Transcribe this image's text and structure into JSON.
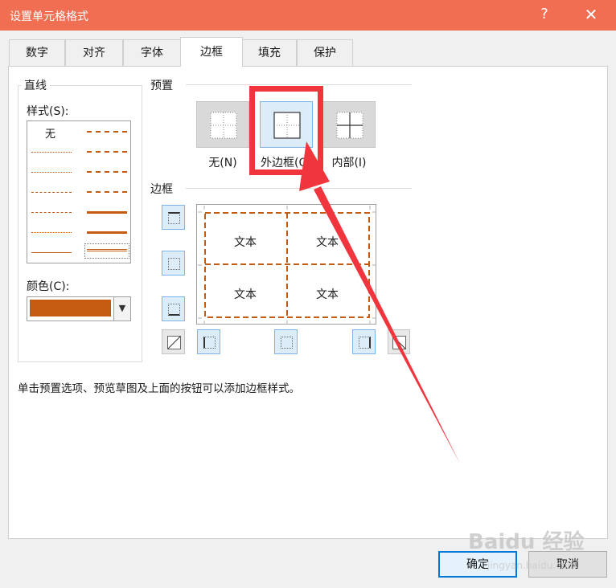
{
  "window": {
    "title": "设置单元格格式",
    "help": "?",
    "close": "✕"
  },
  "tabs": [
    "数字",
    "对齐",
    "字体",
    "边框",
    "填充",
    "保护"
  ],
  "active_tab": "边框",
  "line_group": {
    "legend": "直线",
    "style_label": "样式(S):",
    "none_label": "无",
    "color_label": "颜色(C):",
    "color_value": "#c55a11"
  },
  "preset_group": {
    "legend": "预置",
    "presets": [
      {
        "label": "无(N)"
      },
      {
        "label": "外边框(O)"
      },
      {
        "label": "内部(I)"
      }
    ]
  },
  "border_group": {
    "legend": "边框",
    "cells": [
      "文本",
      "文本",
      "文本",
      "文本"
    ]
  },
  "hint": "单击预置选项、预览草图及上面的按钮可以添加边框样式。",
  "buttons": {
    "ok": "确定",
    "cancel": "取消"
  },
  "annotation_color": "#f0353d",
  "watermark": {
    "brand": "Baidu 经验",
    "url": "jingyan.baidu.com"
  }
}
